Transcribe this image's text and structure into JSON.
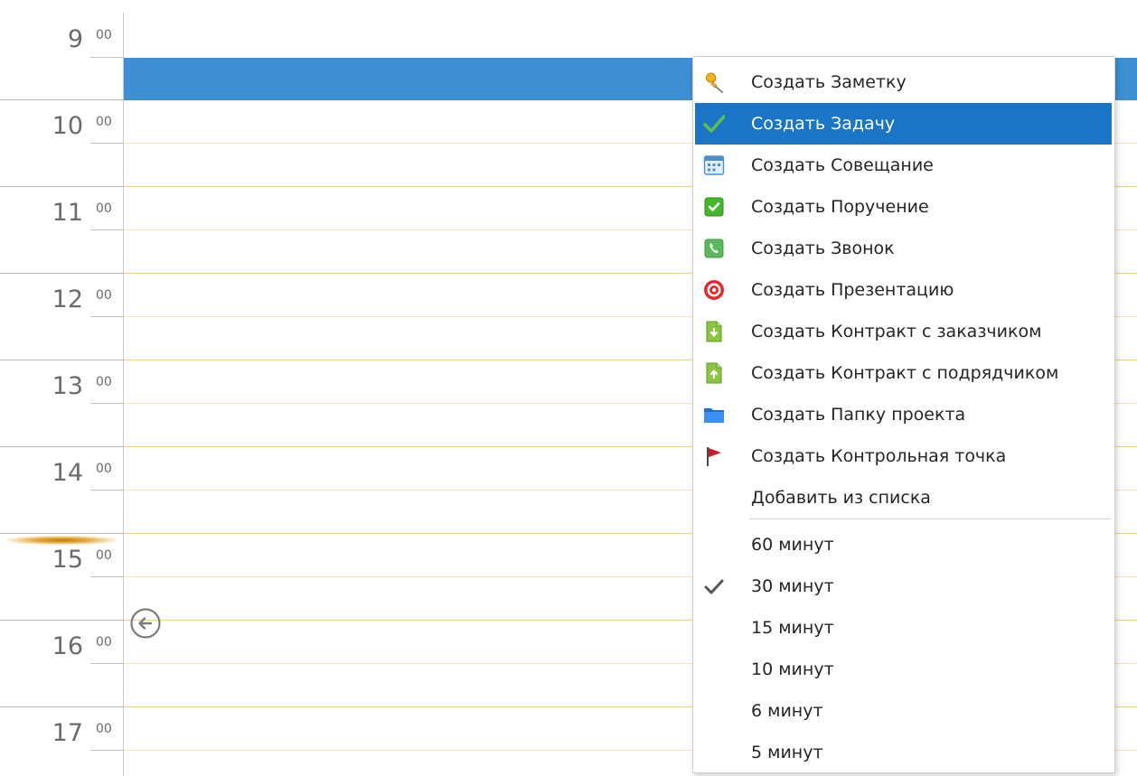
{
  "timeline": {
    "hours": [
      {
        "hour": "9",
        "minutes": "00"
      },
      {
        "hour": "10",
        "minutes": "00"
      },
      {
        "hour": "11",
        "minutes": "00"
      },
      {
        "hour": "12",
        "minutes": "00"
      },
      {
        "hour": "13",
        "minutes": "00"
      },
      {
        "hour": "14",
        "minutes": "00"
      },
      {
        "hour": "15",
        "minutes": "00"
      },
      {
        "hour": "16",
        "minutes": "00"
      },
      {
        "hour": "17",
        "minutes": "00"
      }
    ],
    "selection_color": "#3e8fd3",
    "hour_line_color": "#f1cd8a",
    "half_line_color": "#f8e2b6",
    "back_icon": "arrow-left-circle-icon"
  },
  "context_menu": {
    "create_items": [
      {
        "label": "Создать Заметку",
        "icon": "pushpin-icon"
      },
      {
        "label": "Создать Задачу",
        "icon": "green-check-icon",
        "highlighted": true
      },
      {
        "label": "Создать Совещание",
        "icon": "calendar-meeting-icon"
      },
      {
        "label": "Создать Поручение",
        "icon": "green-checkbox-icon"
      },
      {
        "label": "Создать Звонок",
        "icon": "phone-icon"
      },
      {
        "label": "Создать Презентацию",
        "icon": "target-icon"
      },
      {
        "label": "Создать Контракт с заказчиком",
        "icon": "document-down-icon"
      },
      {
        "label": "Создать Контракт с подрядчиком",
        "icon": "document-up-icon"
      },
      {
        "label": "Создать Папку проекта",
        "icon": "folder-icon"
      },
      {
        "label": "Создать Контрольная точка",
        "icon": "flag-icon"
      },
      {
        "label": "Добавить из списка",
        "icon": ""
      }
    ],
    "interval_items": [
      {
        "label": "60 минут",
        "checked": false
      },
      {
        "label": "30 минут",
        "checked": true
      },
      {
        "label": "15 минут",
        "checked": false
      },
      {
        "label": "10 минут",
        "checked": false
      },
      {
        "label": "6 минут",
        "checked": false
      },
      {
        "label": "5 минут",
        "checked": false
      }
    ],
    "highlight_color": "#1a75c7"
  }
}
